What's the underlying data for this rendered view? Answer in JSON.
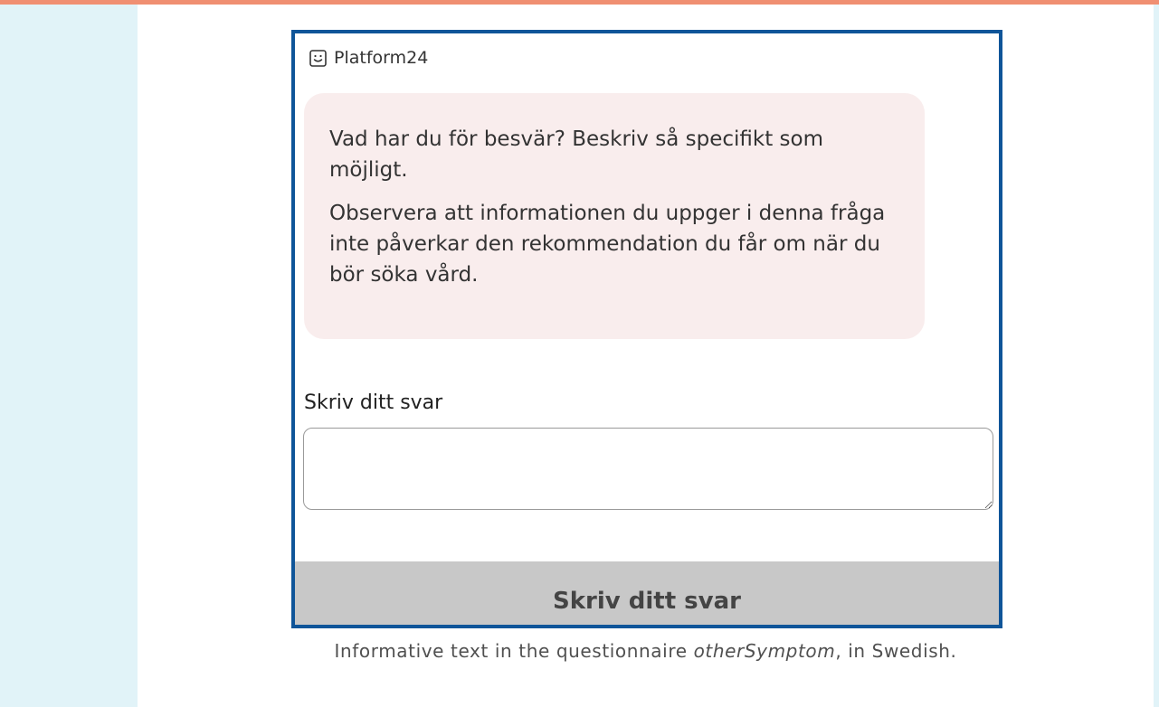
{
  "colors": {
    "top_bar": "#f08f72",
    "side_strip": "#e1f3f8",
    "frame_border": "#0f5599",
    "bubble_bg": "#f9eded",
    "button_bg": "#c8c8c8"
  },
  "header": {
    "icon": "smiley-chat-icon",
    "brand": "Platform24"
  },
  "message": {
    "paragraphs": [
      "Vad har du för besvär? Beskriv så specifikt som möjligt.",
      "Observera att informationen du uppger i denna fråga inte påverkar den rekommendation du får om när du bör söka vård."
    ]
  },
  "answer": {
    "label": "Skriv ditt svar",
    "value": ""
  },
  "submit": {
    "label": "Skriv ditt svar"
  },
  "caption": {
    "before": "Informative text in the questionnaire ",
    "emphasis": "otherSymptom",
    "after": ", in Swedish."
  }
}
